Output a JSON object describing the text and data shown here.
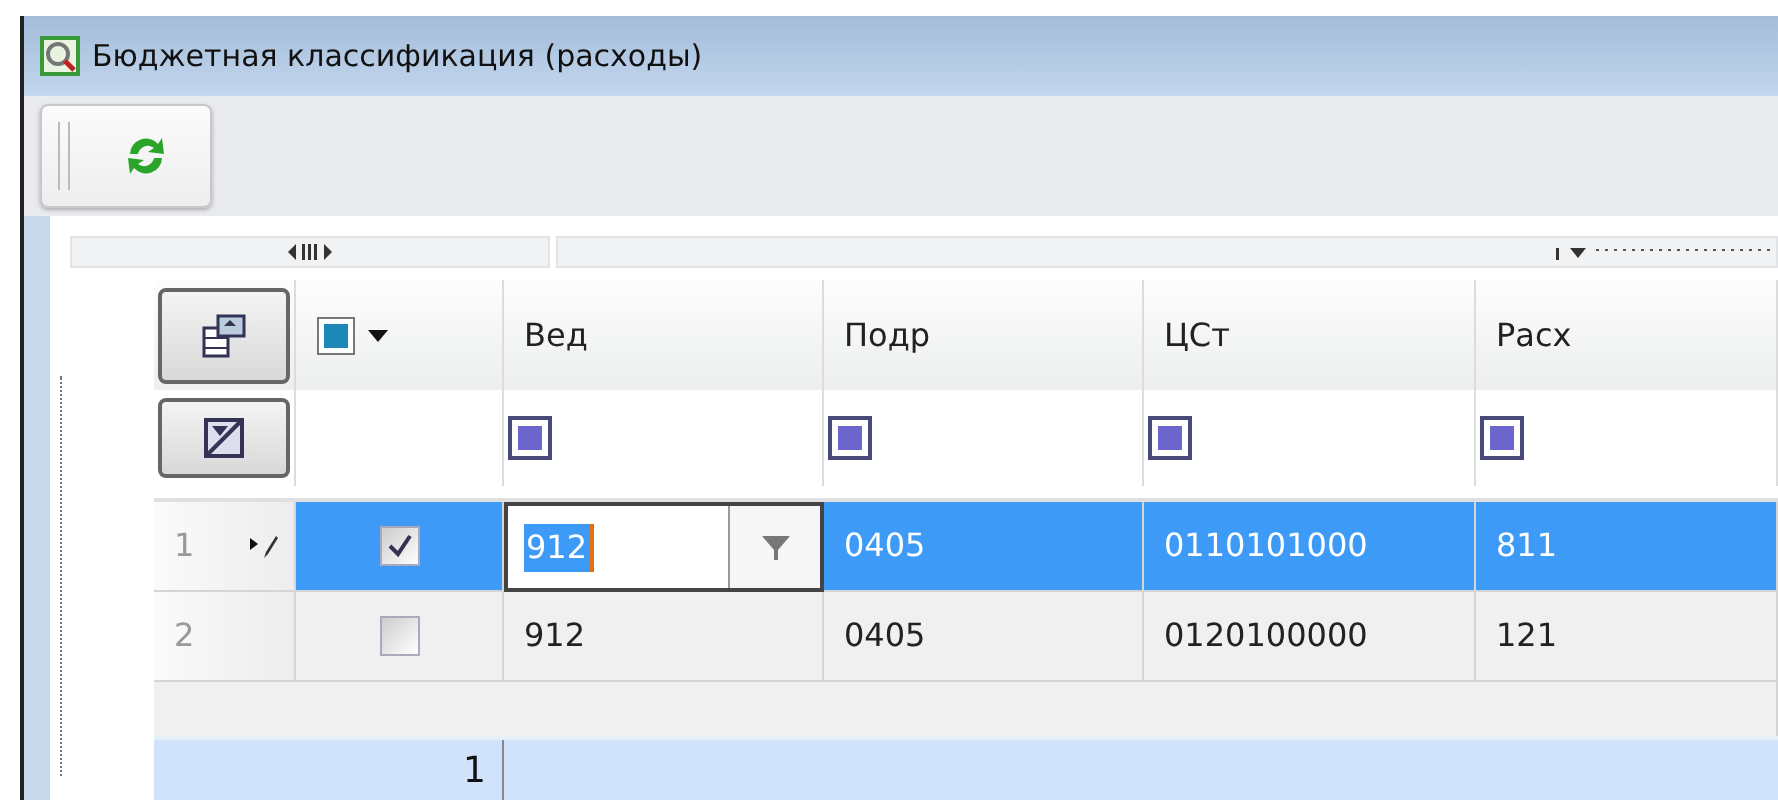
{
  "window": {
    "title": "Бюджетная классификация (расходы)"
  },
  "table": {
    "columns": [
      {
        "label": "Вед"
      },
      {
        "label": "Подр"
      },
      {
        "label": "ЦСт"
      },
      {
        "label": "Расх"
      }
    ],
    "rows": [
      {
        "number": "1",
        "checked": true,
        "selected": true,
        "editing": true,
        "cells": [
          "912",
          "0405",
          "0110101000",
          "811"
        ]
      },
      {
        "number": "2",
        "checked": false,
        "selected": false,
        "editing": false,
        "cells": [
          "912",
          "0405",
          "0120100000",
          "121"
        ]
      }
    ]
  },
  "footer": {
    "count": "1"
  }
}
